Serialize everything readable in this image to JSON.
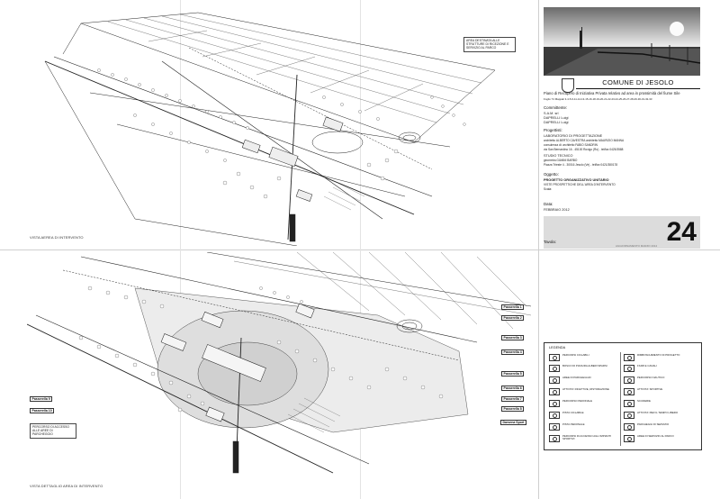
{
  "sheet": {
    "top_view_caption": "VISTA AEREA DI INTERVENTO",
    "bottom_view_caption": "VISTA DETTAGLIO AREA DI INTERVENTO",
    "top_note": "AREA DESTINATA ALLE STRUTTURE DI RICEZIONE E SERVIZIO AL PARCO",
    "bottom_note": "PERCORSO DI ACCESSO ALLE AREE DI PARCHEGGIO",
    "markers": [
      "Passerella 1",
      "Passerella 2",
      "Passerella 3",
      "Passerella 4",
      "Passerella 5",
      "Passerella 6",
      "Passerella 7",
      "Passerella 8",
      "Passerella 9",
      "Passerella 10",
      "Darsena Sport"
    ]
  },
  "title_block": {
    "municipality": "COMUNE DI JESOLO",
    "project_title": "Piano di Recupero di Iniziativa Privata relativo ad area in prossimità del fiume Sile",
    "project_subtitle": "Foglio 74 Mappali 3-4-5-6-11-12-13-15-16-18-19-20-21-22-23-24-25-26-27-28-29-30-31-32-33",
    "client_heading": "Committente:",
    "client_lines": [
      "S.A.M. srl",
      "DAPRELLI Luigi",
      "DAPRELLI Luigi"
    ],
    "designer_heading": "Progettisti:",
    "designer_lines": [
      "LABORATORIO DI PROGETTAZIONE",
      "architetto ALBERTO CAVESTRA  architetto MAURIZIO MANNA",
      "consulenza di: architetto FABIO SANDRIN",
      "via San Bernardino 16 - 45100 Rovigo (Ro) - tel/fax 0425/3588"
    ],
    "studio_heading": "STUDIO TECNICO",
    "studio_lines": [
      "geometra GIANNI BARBO",
      "Piazza Trieste 4 - 30016 Jesolo (Ve) - tel/fax 0421/380178"
    ],
    "subject_heading": "Oggetto:",
    "subject_bold": "PROGETTO ORGANIZZATIVO UNITARIO",
    "subject_lines": [
      "VISTE PROSPETTICHE DELL'AREA D'INTERVENTO",
      "Scala:"
    ],
    "date_heading": "Data:",
    "date_value": "FEBBRAIO 2012",
    "sheet_heading": "Tavola:",
    "sheet_number": "24",
    "revision_note": "AGGIORNAMENTO MARZO 2012"
  },
  "legend": {
    "title": "LEGENDA",
    "left_items": [
      "PERCORSI CICLABILI",
      "BOSCO DI PIANURA ALBERI SPARSI",
      "AREE DI PARCHEGGIO",
      "ATTIVITA' RICETTIVE, RISTORAZIONE",
      "PERCORSO PEDONALE",
      "PISTA CICLABILE",
      "PISTA PEDONALE",
      "PERCORSI DI ACCESSO AGLI IMPIANTI SPORTIVI"
    ],
    "right_items": [
      "RIMBOSCHIMENTO DI PROGETTO",
      "FIUMI E CANALI",
      "PERCORSO NAUTICO",
      "ATTIVITA' SPORTIVE",
      "SCUDERIE",
      "ATTIVITA' PER IL TEMPO LIBERO",
      "PARCHEGGI DI SERVIZIO",
      "AREE DI SERVIZIO AL PARCO"
    ]
  }
}
